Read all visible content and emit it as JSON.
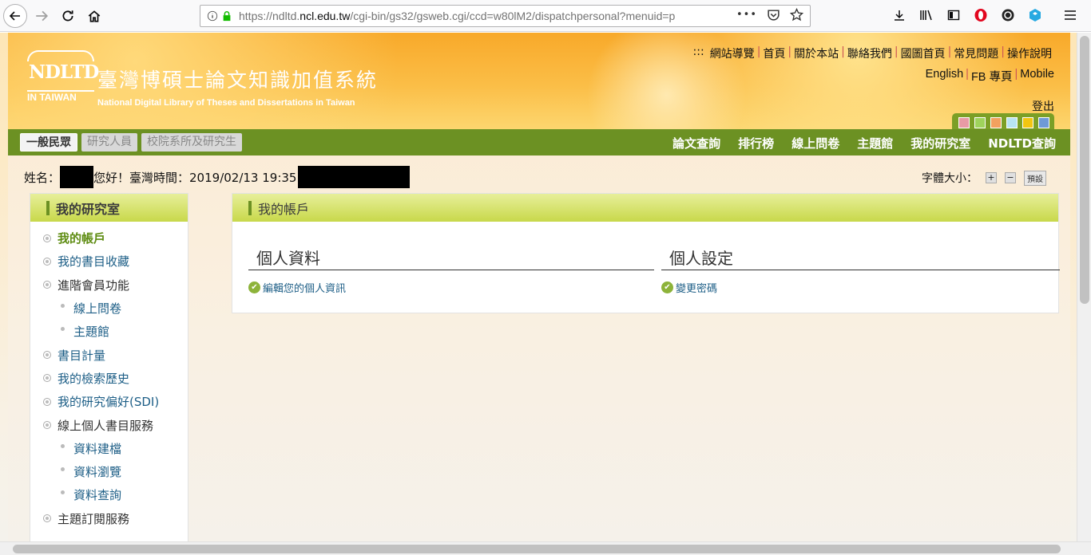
{
  "browser": {
    "url_prefix": "https://ndltd.",
    "url_domain": "ncl.edu.tw",
    "url_suffix": "/cgi-bin/gs32/gsweb.cgi/ccd=w80lM2/dispatchpersonal?menuid=p",
    "more": "•••"
  },
  "header": {
    "logo_mark": "NDLTD",
    "logo_sub": "IN TAIWAN",
    "title_zh": "臺灣博碩士論文知識加值系統",
    "title_en": "National Digital Library of Theses and Dissertations in Taiwan",
    "top_prefix": ":::",
    "top_links": [
      "網站導覽",
      "首頁",
      "關於本站",
      "聯絡我們",
      "國圖首頁",
      "常見問題",
      "操作說明"
    ],
    "lang_links": [
      "English",
      "FB 專頁",
      "Mobile"
    ],
    "logout": "登出",
    "swatch_colors": [
      "#e89aa5",
      "#9fd35c",
      "#f2a15f",
      "#b8e4f2",
      "#f2c511",
      "#6e9ad8"
    ]
  },
  "nav": {
    "roles": [
      "一般民眾",
      "研究人員",
      "校院系所及研究生"
    ],
    "main": [
      "論文查詢",
      "排行榜",
      "線上問卷",
      "主題館",
      "我的研究室",
      "NDLTD查詢"
    ]
  },
  "userline": {
    "name_label": "姓名：",
    "greeting": "您好！臺灣時間：2019/02/13 19:35"
  },
  "font_size": {
    "label": "字體大小：",
    "plus": "+",
    "minus": "−",
    "reset": "預設"
  },
  "sidebar": {
    "title": "我的研究室",
    "items": [
      {
        "label": "我的帳戶",
        "level": 1
      },
      {
        "label": "我的書目收藏",
        "level": 1
      },
      {
        "label": "進階會員功能",
        "level": 1
      },
      {
        "label": "線上問卷",
        "level": 2
      },
      {
        "label": "主題館",
        "level": 2
      },
      {
        "label": "書目計量",
        "level": 1
      },
      {
        "label": "我的檢索歷史",
        "level": 1
      },
      {
        "label": "我的研究偏好(SDI)",
        "level": 1
      },
      {
        "label": "線上個人書目服務",
        "level": 1
      },
      {
        "label": "資料建檔",
        "level": 2
      },
      {
        "label": "資料瀏覽",
        "level": 2
      },
      {
        "label": "資料查詢",
        "level": 2
      },
      {
        "label": "主題訂閱服務",
        "level": 1
      }
    ]
  },
  "main": {
    "title": "我的帳戶",
    "profile_heading": "個人資料",
    "profile_link": "編輯您的個人資訊",
    "settings_heading": "個人設定",
    "settings_link": "變更密碼"
  }
}
